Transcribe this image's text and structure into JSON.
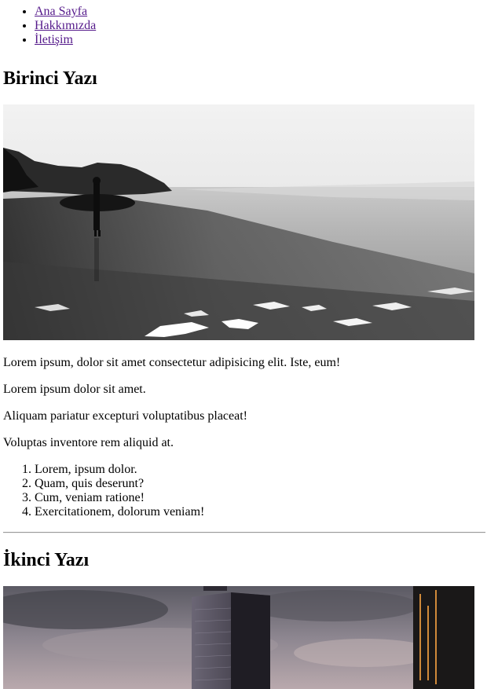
{
  "nav": {
    "items": [
      "Ana Sayfa",
      "Hakkımızda",
      "İletişim"
    ]
  },
  "post1": {
    "title": "Birinci Yazı",
    "image": "beach-surfer-photo",
    "paragraphs": [
      "Lorem ipsum, dolor sit amet consectetur adipisicing elit. Iste, eum!",
      "Lorem ipsum dolor sit amet.",
      "Aliquam pariatur excepturi voluptatibus placeat!",
      "Voluptas inventore rem aliquid at."
    ],
    "list": [
      "Lorem, ipsum dolor.",
      "Quam, quis deserunt?",
      "Cum, veniam ratione!",
      "Exercitationem, dolorum veniam!"
    ]
  },
  "post2": {
    "title": "İkinci Yazı",
    "image": "city-skyscrapers-photo"
  },
  "colors": {
    "link_visited": "#551a8b",
    "rule": "#9a9a9a"
  }
}
